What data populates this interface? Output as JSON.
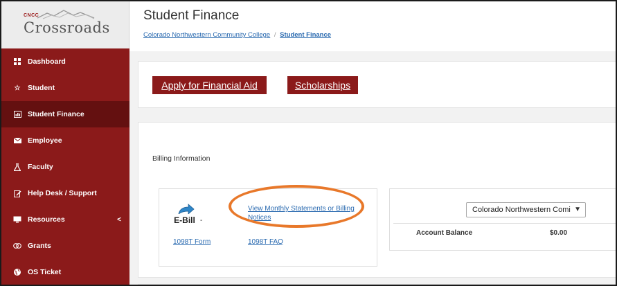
{
  "logo": {
    "small_text": "CNCC",
    "title": "Crossroads"
  },
  "sidebar": {
    "items": [
      {
        "label": "Dashboard",
        "icon": "grid-icon"
      },
      {
        "label": "Student",
        "icon": "star-icon"
      },
      {
        "label": "Student Finance",
        "icon": "chart-icon",
        "active": true
      },
      {
        "label": "Employee",
        "icon": "envelope-icon"
      },
      {
        "label": "Faculty",
        "icon": "flask-icon"
      },
      {
        "label": "Help Desk / Support",
        "icon": "edit-icon"
      },
      {
        "label": "Resources",
        "icon": "monitor-icon",
        "chevron": "<"
      },
      {
        "label": "Grants",
        "icon": "coins-icon"
      },
      {
        "label": "OS Ticket",
        "icon": "globe-icon"
      }
    ]
  },
  "header": {
    "title": "Student Finance",
    "breadcrumb": {
      "home": "Colorado Northwestern Community College",
      "separator": "/",
      "current": "Student Finance"
    }
  },
  "actions": {
    "apply_label": "Apply for Financial Aid",
    "scholarships_label": "Scholarships"
  },
  "billing": {
    "section_label": "Billing Information",
    "ebill_icon_text": "E-Bill",
    "dash": "-",
    "statements_link": "View Monthly Statements or Billing Notices",
    "form_1098t": "1098T Form",
    "faq_1098t": "1098T FAQ"
  },
  "account": {
    "selected_college": "Colorado Northwestern Comi",
    "balance_label": "Account Balance",
    "balance_value": "$0.00"
  },
  "colors": {
    "sidebar": "#8b1a1a",
    "sidebar_active": "#641010",
    "button": "#8b1a1a",
    "link": "#2a6ab0",
    "highlight_oval": "#e8782a"
  }
}
